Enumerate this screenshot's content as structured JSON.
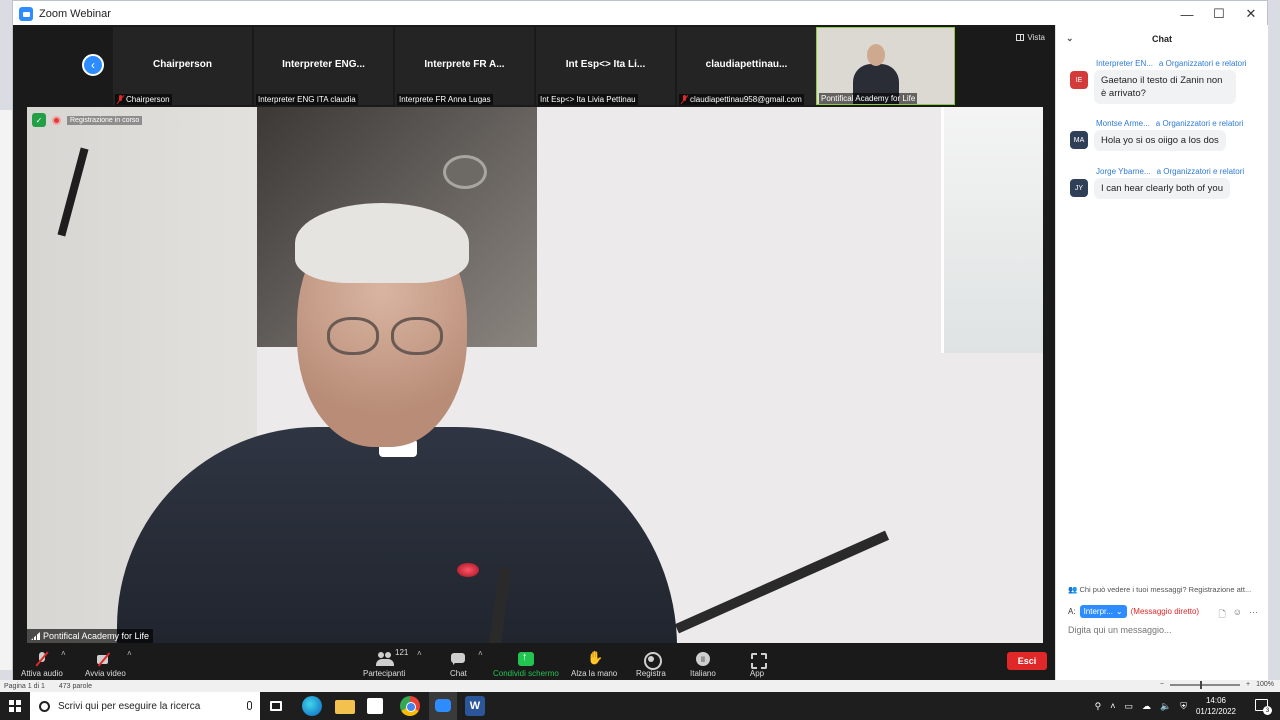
{
  "window": {
    "title": "Zoom Webinar",
    "controls": [
      "—",
      "☐",
      "✕"
    ]
  },
  "strip": {
    "thumbnails": [
      {
        "name": "Chairperson",
        "label": "Chairperson",
        "muted": true
      },
      {
        "name": "Interpreter  ENG...",
        "label": "Interpreter ENG ITA claudia",
        "muted": false
      },
      {
        "name": "Interprete FR  A...",
        "label": "Interprete FR Anna Lugas",
        "muted": false
      },
      {
        "name": "Int Esp<> Ita  Li...",
        "label": "Int Esp<> Ita  Livia Pettinau",
        "muted": false
      },
      {
        "name": "claudiapettinau...",
        "label": "claudiapettinau958@gmail.com",
        "muted": true
      },
      {
        "name": "",
        "label": "Pontifical Academy for Life",
        "muted": false
      }
    ],
    "view_label": "Vista"
  },
  "main_video": {
    "recording_text": "Registrazione in corso",
    "speaker_label": "Pontifical Academy for Life"
  },
  "toolbar": {
    "audio": "Attiva audio",
    "video": "Avvia video",
    "participants": "Partecipanti",
    "participants_count": "121",
    "chat": "Chat",
    "share": "Condividi schermo",
    "raise_hand": "Alza la mano",
    "record": "Registra",
    "language": "Italiano",
    "app": "App",
    "exit": "Esci"
  },
  "chat": {
    "title": "Chat",
    "messages": [
      {
        "sender": "Interpreter EN...",
        "to": "a Organizzatori e relatori",
        "initials": "IE",
        "color": "#d33a3a",
        "text": "Gaetano il testo di Zanin non è arrivato?"
      },
      {
        "sender": "Montse Arme...",
        "to": "a Organizzatori e relatori",
        "initials": "MA",
        "color": "#2f3f58",
        "text": "Hola yo si os oiigo a los dos"
      },
      {
        "sender": "Jorge Ybarne...",
        "to": "a Organizzatori e relatori",
        "initials": "JY",
        "color": "#2f3f58",
        "text": "I can hear clearly  both of you"
      }
    ],
    "notice": "Chi può vedere i tuoi messaggi? Registrazione att...",
    "to_label": "A:",
    "recipient": "Interpr...",
    "direct_tag": "(Messaggio diretto)",
    "input_placeholder": "Digita qui un messaggio..."
  },
  "word_status": {
    "pages": "Pagina 1 di 1",
    "words": "473 parole",
    "zoom": "100%"
  },
  "taskbar": {
    "search_placeholder": "Scrivi qui per eseguire la ricerca",
    "word_letter": "W",
    "time": "14:06",
    "date": "01/12/2022",
    "notification_count": "3"
  }
}
